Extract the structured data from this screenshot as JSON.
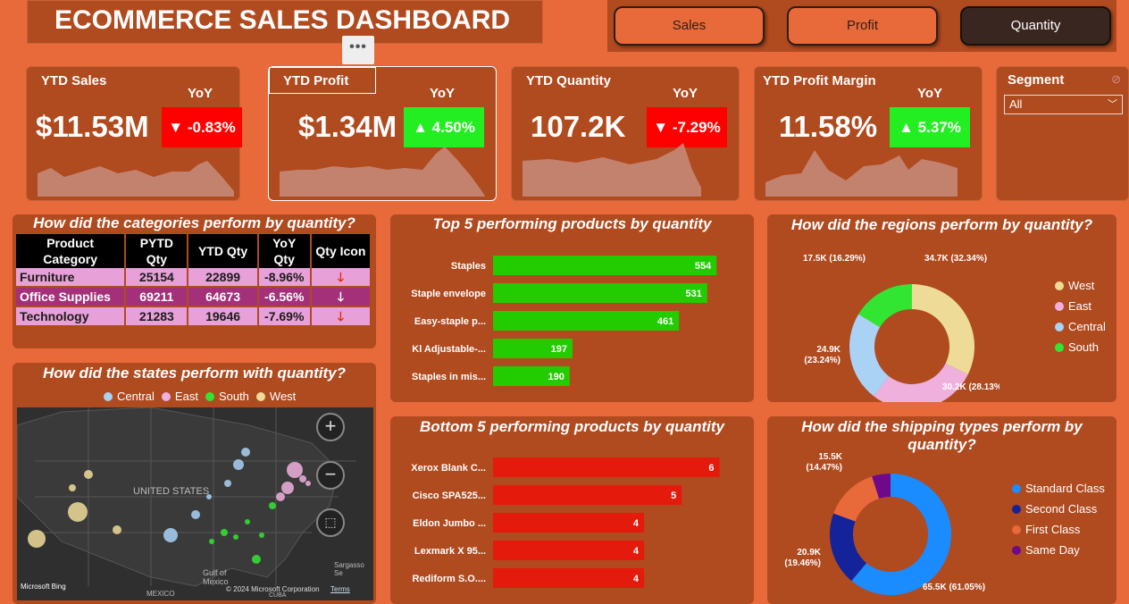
{
  "header": {
    "title": "ECOMMERCE SALES DASHBOARD",
    "more_glyph": "•••"
  },
  "nav": {
    "buttons": [
      "Sales",
      "Profit",
      "Quantity"
    ],
    "active": "Quantity"
  },
  "kpis": [
    {
      "label": "YTD Sales",
      "yoy_label": "YoY",
      "value": "$11.53M",
      "change": "▼ -0.83%",
      "trend": "down"
    },
    {
      "label": "YTD Profit",
      "yoy_label": "YoY",
      "value": "$1.34M",
      "change": "▲  4.50%",
      "trend": "up"
    },
    {
      "label": "YTD Quantity",
      "yoy_label": "YoY",
      "value": "107.2K",
      "change": "▼ -7.29%",
      "trend": "down"
    },
    {
      "label": "YTD Profit Margin",
      "yoy_label": "YoY",
      "value": "11.58%",
      "change": "▲ 5.37%",
      "trend": "up"
    }
  ],
  "segment": {
    "label": "Segment",
    "selected": "All"
  },
  "categories": {
    "title": "How did the categories perform by quantity?",
    "headers": [
      "Product Category",
      "PYTD Qty",
      "YTD Qty",
      "YoY Qty",
      "Qty Icon"
    ],
    "rows": [
      {
        "category": "Furniture",
        "pytd": "25154",
        "ytd": "22899",
        "yoy": "-8.96%",
        "icon": "🡓"
      },
      {
        "category": "Office Supplies",
        "pytd": "69211",
        "ytd": "64673",
        "yoy": "-6.56%",
        "icon": "🡓"
      },
      {
        "category": "Technology",
        "pytd": "21283",
        "ytd": "19646",
        "yoy": "-7.69%",
        "icon": "🡓"
      }
    ]
  },
  "top5": {
    "title": "Top 5 performing products by quantity",
    "chart_data": {
      "type": "bar",
      "categories": [
        "Staples",
        "Staple envelope",
        "Easy-staple p...",
        "Kl Adjustable-...",
        "Staples in mis..."
      ],
      "values": [
        554,
        531,
        461,
        197,
        190
      ],
      "color": "#22cc00"
    }
  },
  "bottom5": {
    "title": "Bottom 5 performing products by quantity",
    "chart_data": {
      "type": "bar",
      "categories": [
        "Xerox Blank C...",
        "Cisco SPA525...",
        "Eldon Jumbo ...",
        "Lexmark X 95...",
        "Rediform S.O...."
      ],
      "values": [
        6,
        5,
        4,
        4,
        4
      ],
      "color": "#e41a0c"
    }
  },
  "regions": {
    "title": "How did the regions perform by quantity?",
    "chart_data": {
      "type": "pie",
      "categories": [
        "West",
        "East",
        "Central",
        "South"
      ],
      "values": [
        34.7,
        30.2,
        24.9,
        17.5
      ],
      "labels": [
        "34.7K (32.34%)",
        "30.2K (28.13%)",
        "24.9K (23.24%)",
        "17.5K (16.29%)"
      ],
      "colors": [
        "#efdb98",
        "#f0b0de",
        "#a9d2f5",
        "#33e533"
      ]
    }
  },
  "shipping": {
    "title": "How did the shipping types perform by quantity?",
    "chart_data": {
      "type": "pie",
      "categories": [
        "Standard Class",
        "Second Class",
        "First Class",
        "Same Day"
      ],
      "values": [
        65.5,
        20.9,
        15.5,
        5.3
      ],
      "labels": [
        "65.5K (61.05%)",
        "20.9K (19.46%)",
        "15.5K (14.47%)",
        ""
      ],
      "colors": [
        "#1a8cff",
        "#14239a",
        "#e8693a",
        "#6e0a8a"
      ]
    }
  },
  "states": {
    "title": "How did the states perform with quantity?",
    "legend": [
      "Central",
      "East",
      "South",
      "West"
    ],
    "legend_colors": [
      "#a9d2f5",
      "#f0b0de",
      "#33e533",
      "#efdb98"
    ],
    "map_labels": {
      "country": "UNITED STATES",
      "gulf": "Gulf of Mexico",
      "mexico": "MEXICO",
      "cuba": "CUBA",
      "sargasso": "Sargasso Se",
      "brand": "Microsoft Bing",
      "copyright": "© 2024 Microsoft Corporation",
      "terms": "Terms"
    }
  }
}
